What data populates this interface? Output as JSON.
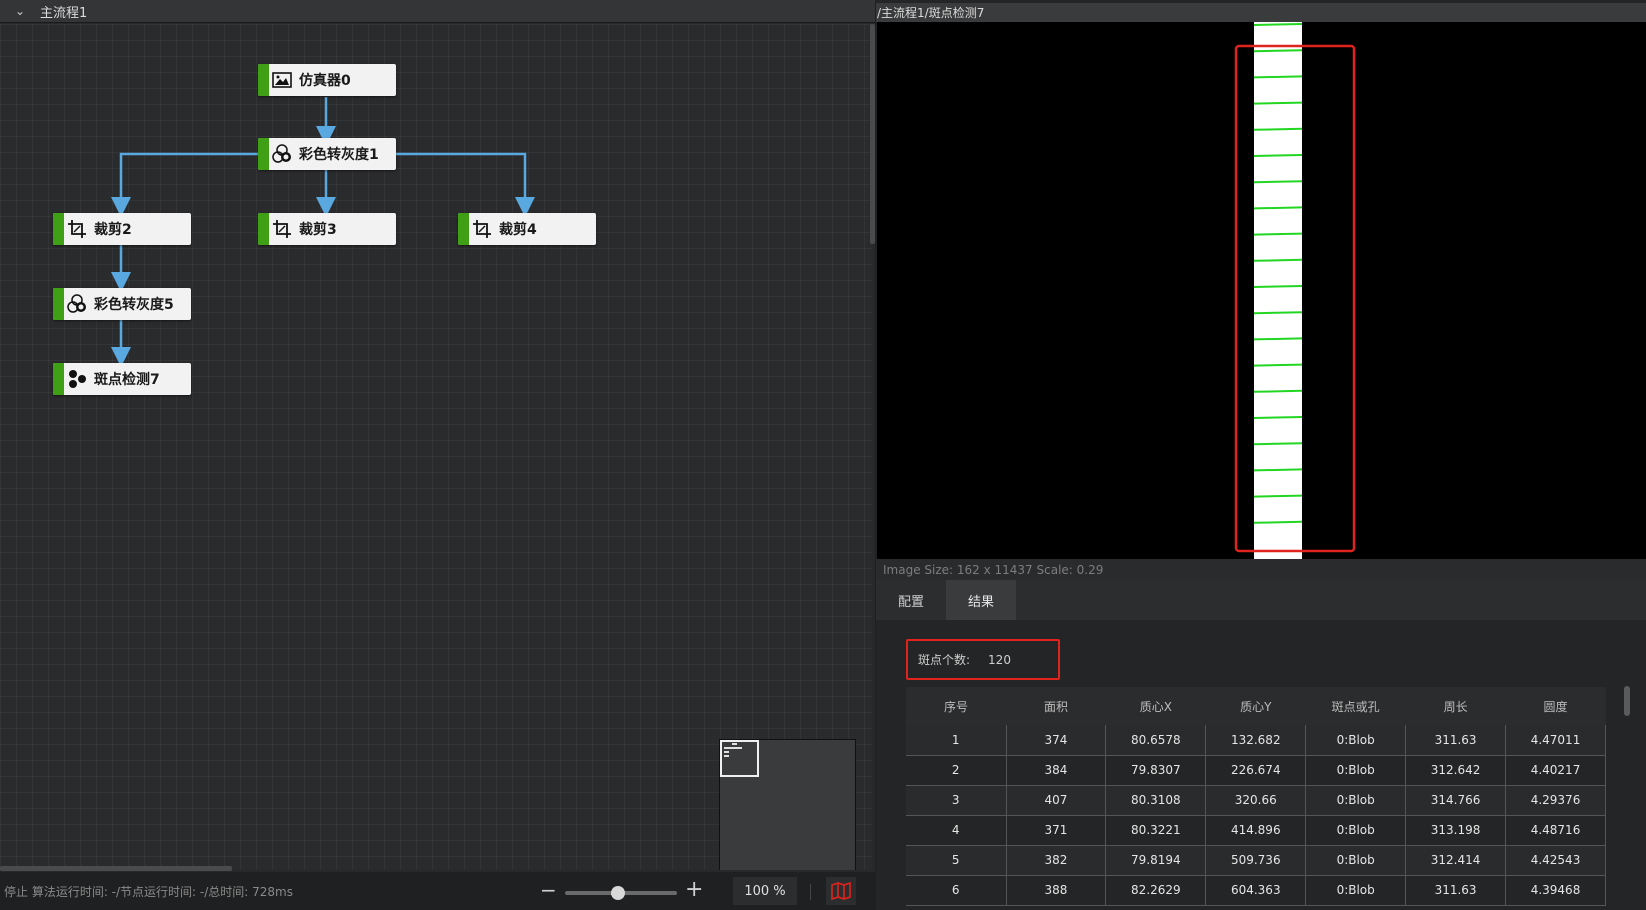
{
  "left_panel": {
    "title": "主流程1",
    "nodes": [
      {
        "label": "仿真器0",
        "icon": "image-icon"
      },
      {
        "label": "彩色转灰度1",
        "icon": "color-to-gray-icon"
      },
      {
        "label": "裁剪2",
        "icon": "crop-icon"
      },
      {
        "label": "裁剪3",
        "icon": "crop-icon"
      },
      {
        "label": "裁剪4",
        "icon": "crop-icon"
      },
      {
        "label": "彩色转灰度5",
        "icon": "color-to-gray-icon"
      },
      {
        "label": "斑点检测7",
        "icon": "blob-icon"
      }
    ],
    "status": "停止 算法运行时间: -/节点运行时间: -/总时间: 728ms",
    "zoom": "100 %",
    "colors": {
      "node_bar": "#3fa016",
      "edge": "#5aa8e0"
    }
  },
  "right_panel": {
    "path": "/主流程1/斑点检测7",
    "image_info": "Image Size: 162 x 11437 Scale: 0.29",
    "tabs": [
      "配置",
      "结果"
    ],
    "active_tab": "结果",
    "blob_count_label": "斑点个数:",
    "blob_count_value": "120",
    "table": {
      "headers": [
        "序号",
        "面积",
        "质心X",
        "质心Y",
        "斑点或孔",
        "周长",
        "圆度"
      ],
      "rows": [
        [
          "1",
          "374",
          "80.6578",
          "132.682",
          "0:Blob",
          "311.63",
          "4.47011"
        ],
        [
          "2",
          "384",
          "79.8307",
          "226.674",
          "0:Blob",
          "312.642",
          "4.40217"
        ],
        [
          "3",
          "407",
          "80.3108",
          "320.66",
          "0:Blob",
          "314.766",
          "4.29376"
        ],
        [
          "4",
          "371",
          "80.3221",
          "414.896",
          "0:Blob",
          "313.198",
          "4.48716"
        ],
        [
          "5",
          "382",
          "79.8194",
          "509.736",
          "0:Blob",
          "312.414",
          "4.42543"
        ],
        [
          "6",
          "388",
          "82.2629",
          "604.363",
          "0:Blob",
          "311.63",
          "4.39468"
        ]
      ]
    },
    "colors": {
      "highlight": "#e0231c",
      "blob_line": "#22d622"
    }
  }
}
